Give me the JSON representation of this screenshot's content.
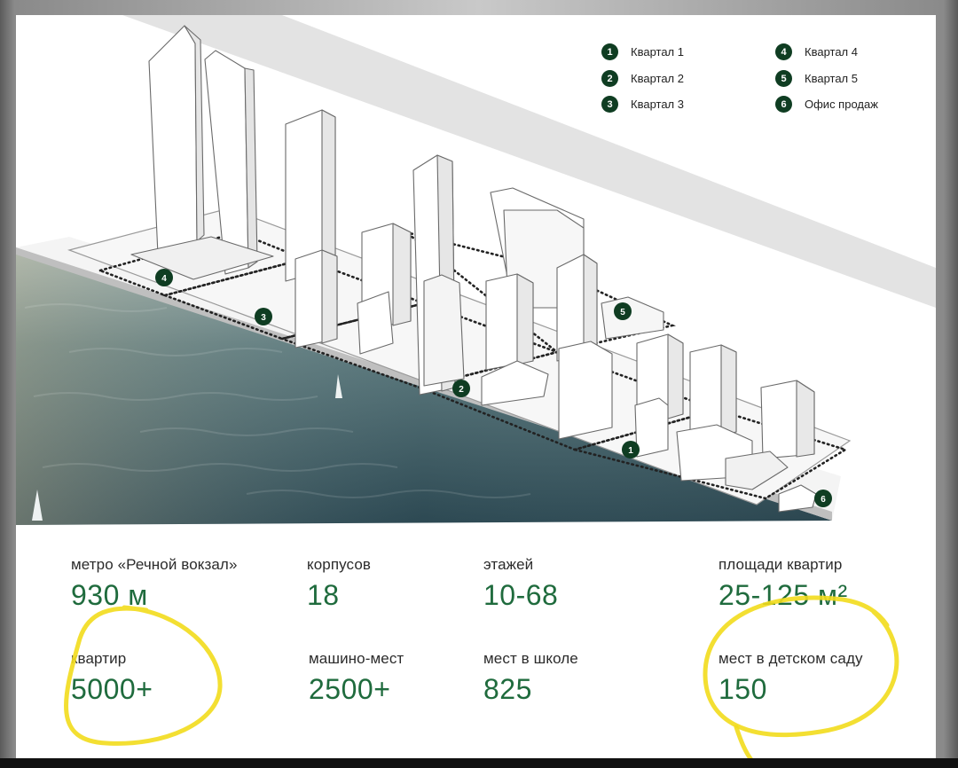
{
  "legend": [
    {
      "num": "1",
      "label": "Квартал 1"
    },
    {
      "num": "2",
      "label": "Квартал 2"
    },
    {
      "num": "3",
      "label": "Квартал 3"
    },
    {
      "num": "4",
      "label": "Квартал 4"
    },
    {
      "num": "5",
      "label": "Квартал 5"
    },
    {
      "num": "6",
      "label": "Офис продаж"
    }
  ],
  "markers": [
    "1",
    "2",
    "3",
    "4",
    "5",
    "6"
  ],
  "stats": [
    {
      "label": "метро «Речной вокзал»",
      "value": "930 м"
    },
    {
      "label": "корпусов",
      "value": "18"
    },
    {
      "label": "этажей",
      "value": "10-68"
    },
    {
      "label": "площади квартир",
      "value": "25-125 м²"
    },
    {
      "label": "квартир",
      "value": "5000+"
    },
    {
      "label": "машино-мест",
      "value": "2500+"
    },
    {
      "label": "мест в школе",
      "value": "825"
    },
    {
      "label": "мест в детском саду",
      "value": "150"
    }
  ],
  "colors": {
    "accent_green": "#1f6b3d",
    "marker_green": "#0f3d22",
    "highlight_yellow": "#f2dc1c"
  }
}
